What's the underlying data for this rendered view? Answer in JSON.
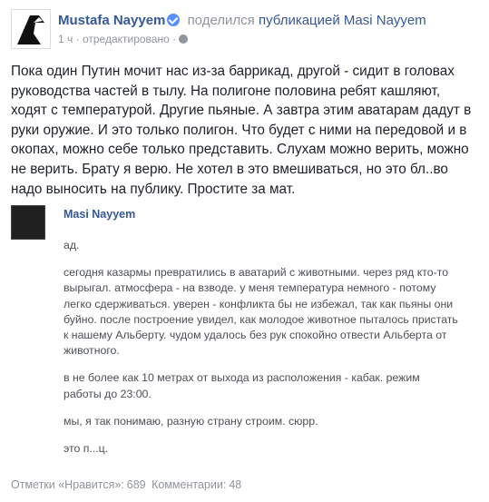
{
  "header": {
    "author": "Mustafa Nayyem",
    "action_text": "поделился",
    "action_link": "публикацией Masi Nayyem",
    "time": "1 ч",
    "separator": "·",
    "edited": "отредактировано",
    "separator2": "·"
  },
  "post": {
    "text": "Пока один Путин мочит нас из-за баррикад, другой - сидит в головах\nруководства частей в тылу. На полигоне половина ребят кашляют,\nходят с температурой. Другие пьяные. А завтра этим аватарам дадут в\nруки оружие. И это только полигон. Что будет с ними на передовой и в\nокопах, можно себе только представить. Слухам можно верить, можно\nне верить. Брату я верю. Не хотел в это вмешиваться, но это бл..во\nнадо выносить на публику. Простите за мат."
  },
  "shared": {
    "author": "Masi Nayyem",
    "paragraphs": [
      "ад.",
      "сегодня казармы превратились в аватарий с животными. через ряд кто-то\nвырыгал. атмосфера - на взводе. у меня температура немного - потому\nлегко сдерживаться. уверен - конфликта бы не избежал, так как пьяны они\nбуйно. после построение увидел, как молодое животное пыталось пристать\nк нашему Альберту. чудом удалось без рук спокойно отвести Альберта от\nживотного.",
      "в не более как 10 метрах от выхода из расположения - кабак. режим\nработы до 23:00.",
      "мы, я так понимаю, разную страну строим. сюрр.",
      "это п...ц."
    ]
  },
  "footer": {
    "likes_label": "Отметки «Нравится»:",
    "likes_count": "689",
    "comments_label": "Комментарии:",
    "comments_count": "48"
  }
}
